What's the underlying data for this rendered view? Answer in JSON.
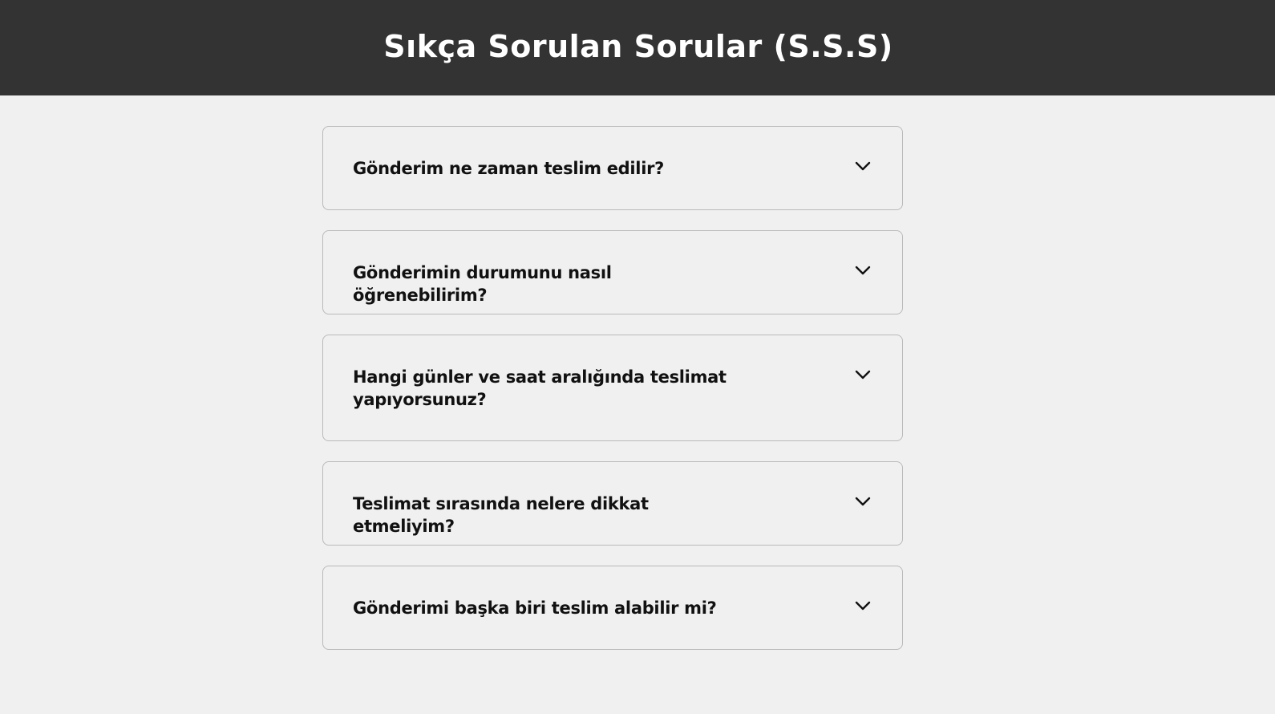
{
  "header": {
    "title": "Sıkça Sorulan Sorular (S.S.S)",
    "background": "#333333",
    "title_color": "#ffffff"
  },
  "faq": {
    "items": [
      {
        "question": "Gönderim ne zaman teslim edilir?"
      },
      {
        "question": "Gönderimin durumunu nasıl öğrenebilirim?"
      },
      {
        "question": "Hangi günler ve saat aralığında teslimat yapıyorsunuz?"
      },
      {
        "question": "Teslimat sırasında nelere dikkat etmeliyim?"
      },
      {
        "question": "Gönderimi başka biri teslim alabilir mi?"
      }
    ],
    "toggle_icon": "chevron-down-icon"
  },
  "colors": {
    "page_background": "#f0f0f0",
    "card_border": "#b9b9b9",
    "question_text": "#111111"
  }
}
